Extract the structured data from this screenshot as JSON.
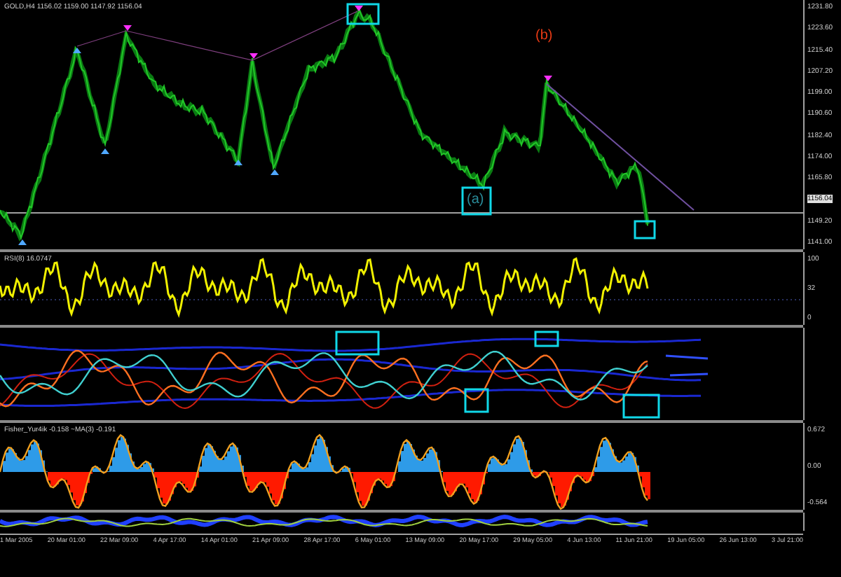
{
  "chart": {
    "symbol_label": "GOLD,H4 1156.02 1159.00 1147.92 1156.04",
    "price_axis": [
      {
        "text": "1231.80",
        "kind": "tick"
      },
      {
        "text": "1223.60",
        "kind": "tick"
      },
      {
        "text": "1215.40",
        "kind": "tick"
      },
      {
        "text": "1207.20",
        "kind": "tick"
      },
      {
        "text": "1199.00",
        "kind": "tick"
      },
      {
        "text": "1190.60",
        "kind": "tick"
      },
      {
        "text": "1182.40",
        "kind": "tick"
      },
      {
        "text": "1174.00",
        "kind": "tick"
      },
      {
        "text": "1165.80",
        "kind": "tick"
      },
      {
        "text": "1156.04",
        "kind": "current"
      },
      {
        "text": "1149.20",
        "kind": "tick"
      },
      {
        "text": "1141.00",
        "kind": "tick"
      }
    ],
    "annotations": [
      {
        "text": "(b)",
        "color": "#e83a14"
      },
      {
        "text": "(a)",
        "color": "#2a8c9a"
      }
    ]
  },
  "rsi": {
    "label": "RSI(8) 16.0747",
    "axis": [
      "100",
      "32",
      "0"
    ]
  },
  "fisher": {
    "label": "Fisher_Yur4ik -0.158 ~MA(3) -0.191",
    "axis": [
      "0.672",
      "0.00",
      "-0.564"
    ]
  },
  "time_axis": [
    "1 Mar 2005",
    "20 Mar 01:00",
    "22 Mar 09:00",
    "4 Apr 17:00",
    "14 Apr 01:00",
    "21 Apr 09:00",
    "28 Apr 17:00",
    "6 May 01:00",
    "13 May 09:00",
    "20 May 17:00",
    "29 May 05:00",
    "4 Jun 13:00",
    "11 Jun 21:00",
    "19 Jun 05:00",
    "26 Jun 13:00",
    "3 Jul 21:00"
  ]
}
